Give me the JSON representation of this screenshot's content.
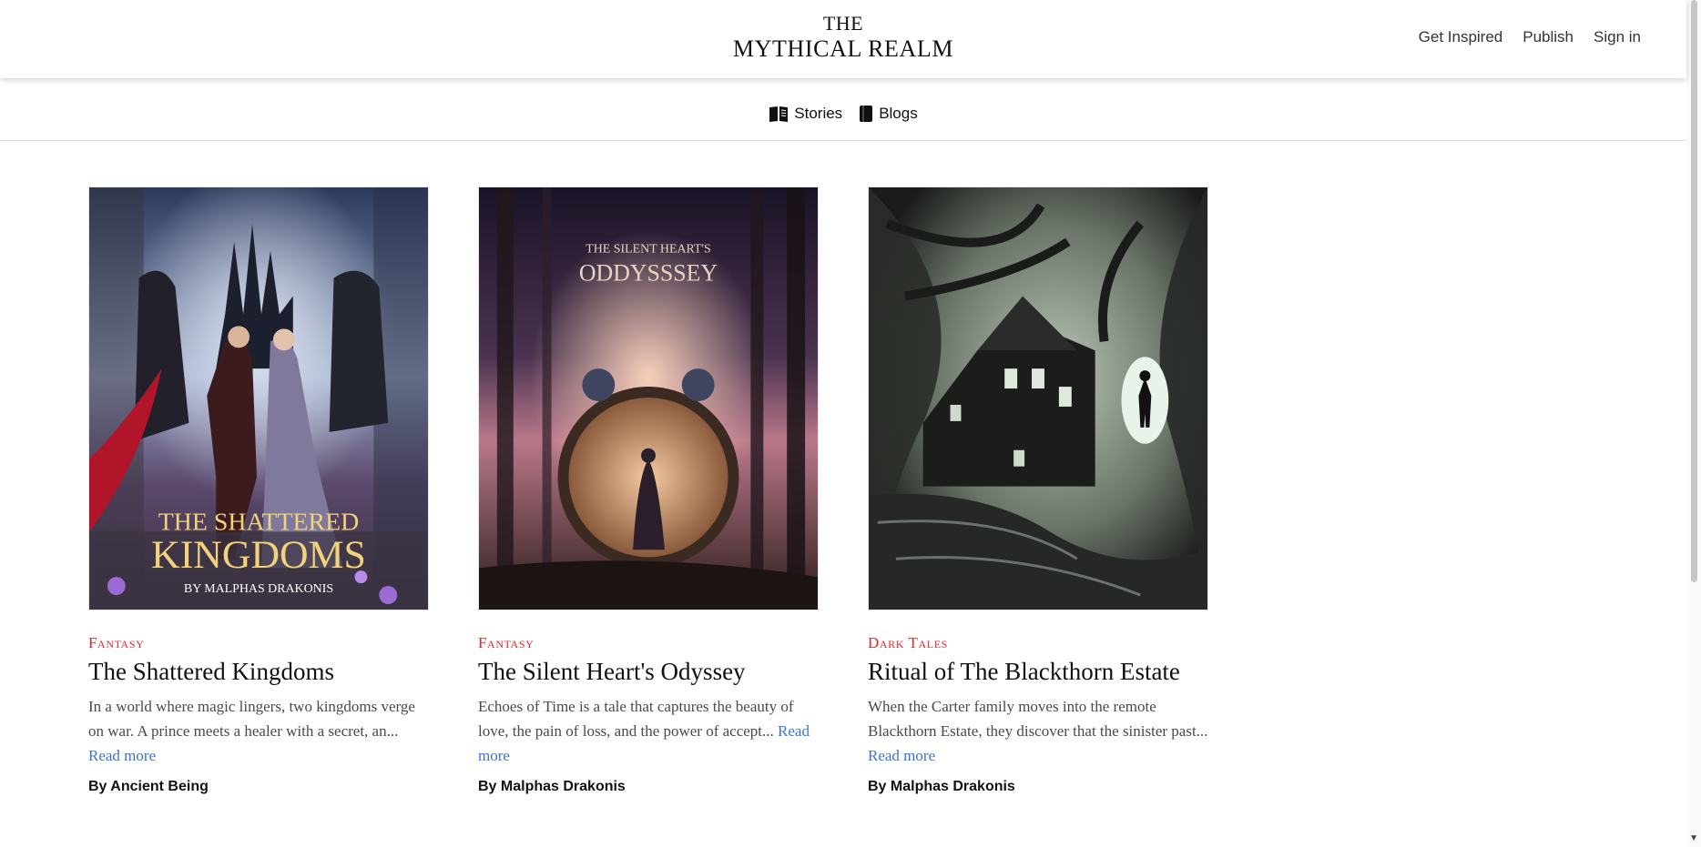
{
  "header": {
    "brand_line1": "THE",
    "brand_line2": "MYTHICAL REALM",
    "nav": [
      "Get Inspired",
      "Publish",
      "Sign in"
    ]
  },
  "subnav": {
    "items": [
      {
        "label": "Stories",
        "icon": "open-book-icon"
      },
      {
        "label": "Blogs",
        "icon": "book-icon"
      }
    ]
  },
  "cards": [
    {
      "category": "Fantasy",
      "title": "The Shattered Kingdoms",
      "desc": "In a world where magic lingers, two kingdoms verge on war. A prince meets a healer with a secret, an...",
      "more": " Read more",
      "author": "By Ancient Being",
      "cover_text1": "THE SHATTERED",
      "cover_text2": "KINGDOMS",
      "cover_text3": "BY MALPHAS DRAKONIS"
    },
    {
      "category": "Fantasy",
      "title": "The Silent Heart's Odyssey",
      "desc": "Echoes of Time is a tale that captures the beauty of love, the pain of loss, and the power of accept...",
      "more": " Read more",
      "author": "By Malphas Drakonis",
      "cover_text1": "THE SILENT HEART'S",
      "cover_text2": "ODDYSSSEY"
    },
    {
      "category": "Dark Tales",
      "title": "Ritual of The Blackthorn Estate",
      "desc": "When the Carter family moves into the remote Blackthorn Estate, they discover that the sinister past...",
      "more": " Read more",
      "author": "By Malphas Drakonis"
    }
  ],
  "colors": {
    "category": "#e0282e",
    "link": "#3a73d8"
  }
}
